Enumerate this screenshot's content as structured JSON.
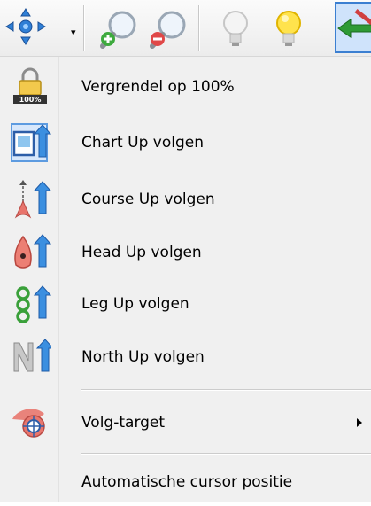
{
  "toolbar": {
    "buttons": [
      {
        "name": "pan-icon"
      },
      {
        "name": "zoom-in-icon"
      },
      {
        "name": "zoom-out-icon"
      },
      {
        "name": "lightbulb-off-icon"
      },
      {
        "name": "lightbulb-on-icon"
      },
      {
        "name": "route-arrow-icon"
      }
    ],
    "dropdown_glyph": "▾"
  },
  "menu": {
    "items": [
      {
        "label": "Vergrendel op 100%",
        "icon": "lock-100-icon",
        "badge": "100%"
      },
      {
        "label": "Chart Up volgen",
        "icon": "chart-up-icon",
        "selected": true
      },
      {
        "label": "Course Up volgen",
        "icon": "course-up-icon"
      },
      {
        "label": "Head Up volgen",
        "icon": "head-up-icon"
      },
      {
        "label": "Leg Up volgen",
        "icon": "leg-up-icon"
      },
      {
        "label": "North Up volgen",
        "icon": "north-up-icon"
      },
      {
        "label": "Volg-target",
        "icon": "target-icon",
        "submenu": true
      },
      {
        "label": "Automatische cursor positie"
      }
    ]
  },
  "colors": {
    "accent": "#3b7fd1",
    "selection_fill": "#d7e7fb",
    "menu_bg": "#f0f0f0"
  }
}
